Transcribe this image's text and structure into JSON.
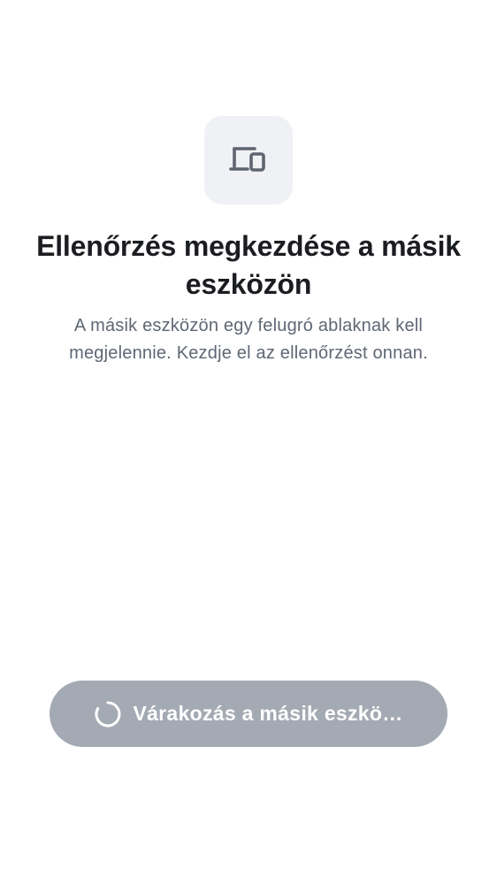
{
  "icon": {
    "name": "devices-icon",
    "tile_color": "#eff1f5",
    "glyph_color": "#5f6570"
  },
  "heading": {
    "title": "Ellenőrzés megkezdése a másik eszközön",
    "subtitle": "A másik eszközön egy felugró ablaknak kell megjelennie. Kezdje el az ellenőrzést onnan."
  },
  "wait_button": {
    "label": "Várakozás a másik eszkö…",
    "icon": "spinner-icon",
    "state": "disabled",
    "color": "#a4aab3"
  },
  "colors": {
    "title": "#1b1d21",
    "subtitle": "#5f6775",
    "background": "#ffffff"
  }
}
